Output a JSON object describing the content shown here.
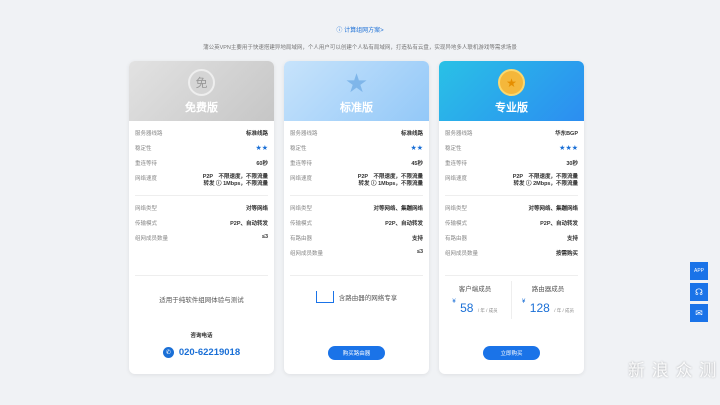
{
  "top_link": "ⓘ 计算组网方案>",
  "intro": "蒲公英VPN主要用于快速搭建异地局域网，个人用户可以创建个人私有局域网，打造私有云盘，实现异地多人联机游戏等需求场景",
  "labels": {
    "line": "服务器线路",
    "stability": "稳定性",
    "latency": "重连等待",
    "network_speed": "网络速度",
    "network_type": "网络类型",
    "transfer_mode": "传输模式",
    "router": "有路由器",
    "member_count": "组网成员数量"
  },
  "cards": [
    {
      "title": "免费版",
      "badge": "免",
      "line": "标准线路",
      "stars": "★★",
      "latency": "60秒",
      "speed": "P2P　不限速度，不限流量\n转发 ⓘ 1Mbps，不限流量",
      "network_type": "对等网络",
      "transfer_mode": "P2P、自动转发",
      "member_count": "≤3",
      "desc": "适用于纯软件组网体验与测试",
      "consult_label": "咨询电话",
      "phone": "020-62219018"
    },
    {
      "title": "标准版",
      "badge": "★",
      "line": "标准线路",
      "stars": "★★",
      "latency": "45秒",
      "speed": "P2P　不限速度，不限流量\n转发 ⓘ 1Mbps，不限流量",
      "network_type": "对等网络、集蹦网络",
      "transfer_mode": "P2P、自动转发",
      "router": "支持",
      "member_count": "≤3",
      "desc": "含路由器的网络专享",
      "button": "购买路由器"
    },
    {
      "title": "专业版",
      "badge": "★",
      "line": "华东BGP",
      "stars": "★★★",
      "latency": "30秒",
      "speed": "P2P　不限速度，不限流量\n转发 ⓘ 2Mbps，不限流量",
      "network_type": "对等网络、集蹦网络",
      "transfer_mode": "P2P、自动转发",
      "router": "支持",
      "member_count": "按需购买",
      "client_label": "客户端成员",
      "client_price": "58",
      "router_label": "路由器成员",
      "router_price": "128",
      "price_unit": "/ 年 / 成员",
      "currency": "¥",
      "button": "立即购买"
    }
  ],
  "side": {
    "app": "APP"
  },
  "watermark": "新 浪 众 测"
}
